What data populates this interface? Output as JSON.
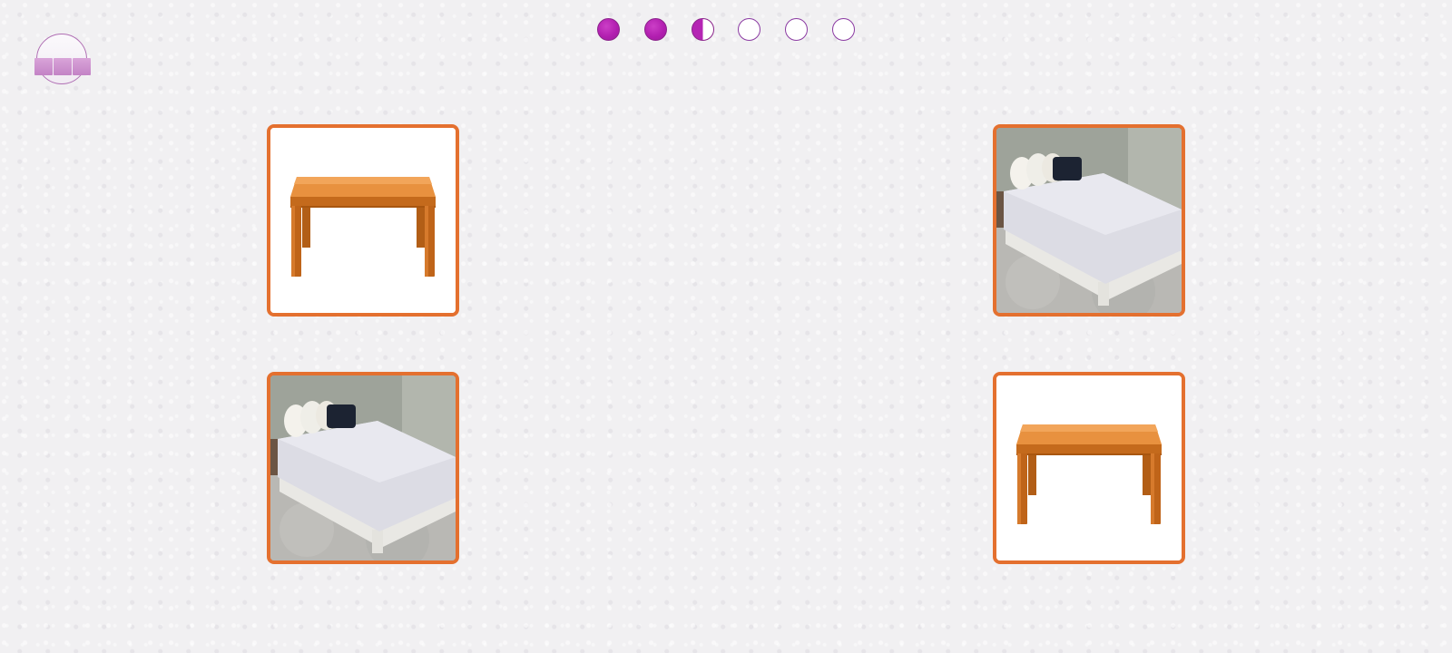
{
  "game": {
    "progress": {
      "total": 6,
      "completed": 2,
      "current_index": 3,
      "dots": [
        "done",
        "done",
        "current",
        "empty",
        "empty",
        "empty"
      ]
    },
    "menu_button_icon": "menu-icon",
    "cards": [
      {
        "id": "card-1",
        "picture": "table",
        "icon": "table-icon"
      },
      {
        "id": "card-2",
        "picture": "bed",
        "icon": "bed-icon"
      },
      {
        "id": "card-3",
        "picture": "bed",
        "icon": "bed-icon"
      },
      {
        "id": "card-4",
        "picture": "table",
        "icon": "table-icon"
      }
    ],
    "colors": {
      "card_border": "#e4702f",
      "progress_fill": "#b525b4",
      "progress_border": "#8b238b",
      "background": "#f1f0f2"
    }
  }
}
